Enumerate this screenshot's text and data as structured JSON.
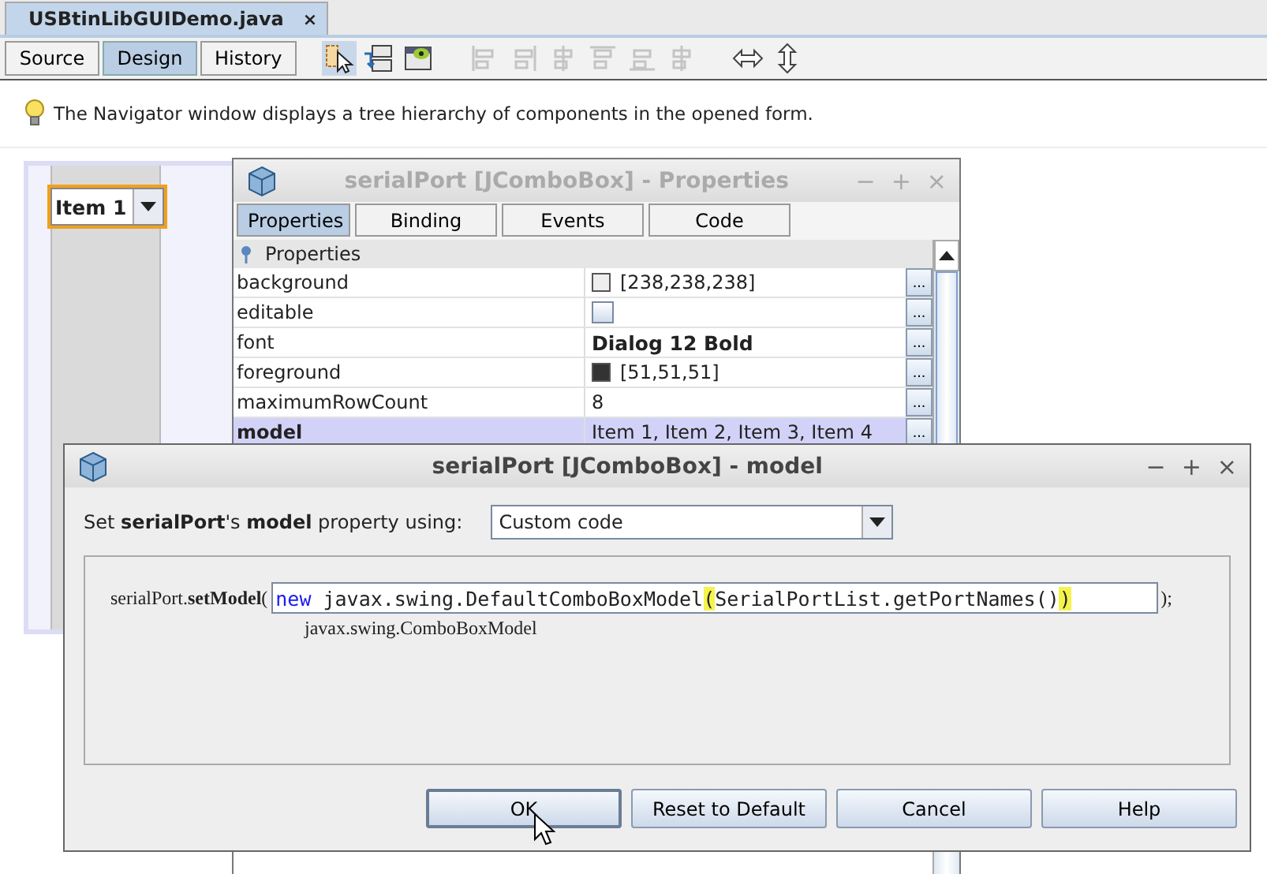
{
  "file_tab": {
    "title": "USBtinLibGUIDemo.java",
    "close": "×",
    "selected": true
  },
  "view_tabs": [
    {
      "label": "Source",
      "selected": false
    },
    {
      "label": "Design",
      "selected": true
    },
    {
      "label": "History",
      "selected": false
    }
  ],
  "tools": [
    {
      "kind": "select",
      "selected": true
    },
    {
      "kind": "connect",
      "selected": false
    },
    {
      "kind": "preview",
      "selected": false
    }
  ],
  "align_tools": [
    {
      "kind": "left",
      "disabled": true
    },
    {
      "kind": "right",
      "disabled": true
    },
    {
      "kind": "center",
      "disabled": true
    },
    {
      "kind": "top",
      "disabled": true
    },
    {
      "kind": "bottom",
      "disabled": true
    },
    {
      "kind": "middle",
      "disabled": true
    }
  ],
  "resize_tools": [
    {
      "kind": "horizontal",
      "disabled": false
    },
    {
      "kind": "vertical",
      "disabled": false
    }
  ],
  "hint": "The Navigator window displays a tree hierarchy of components in the opened form.",
  "form": {
    "combo_value": "Item 1",
    "selected": true
  },
  "properties_window": {
    "title": "serialPort [JComboBox] - Properties",
    "active": false,
    "controls": [
      "−",
      "+",
      "×"
    ],
    "tabs": [
      {
        "label": "Properties",
        "selected": true
      },
      {
        "label": "Binding",
        "selected": false
      },
      {
        "label": "Events",
        "selected": false
      },
      {
        "label": "Code",
        "selected": false
      }
    ],
    "section": "Properties",
    "rows": [
      {
        "name": "background",
        "kind": "color",
        "value": "[238,238,238]",
        "color": "#eeeeee",
        "selected": false,
        "edit": "..."
      },
      {
        "name": "editable",
        "kind": "checkbox",
        "checked": false,
        "selected": false,
        "edit": "..."
      },
      {
        "name": "font",
        "kind": "font",
        "value": "Dialog 12 Bold",
        "selected": false,
        "edit": "..."
      },
      {
        "name": "foreground",
        "kind": "color",
        "value": "[51,51,51]",
        "color": "#333333",
        "selected": false,
        "edit": "..."
      },
      {
        "name": "maximumRowCount",
        "kind": "text",
        "value": "8",
        "selected": false,
        "edit": "..."
      },
      {
        "name": "model",
        "kind": "text",
        "value": "Item 1, Item 2, Item 3, Item 4",
        "selected": true,
        "edit": "..."
      }
    ]
  },
  "model_dialog": {
    "title": "serialPort [JComboBox] - model",
    "active": true,
    "controls": [
      "−",
      "+",
      "×"
    ],
    "prompt": "Set **serialPort**'s **model** property using:",
    "editor_choice": "Custom code",
    "code_prefix": "serialPort.**setModel**(",
    "code_tokens": [
      {
        "text": "new",
        "kind": "keyword"
      },
      {
        "text": " javax.swing.DefaultComboBoxModel",
        "kind": "plain"
      },
      {
        "text": "(",
        "kind": "match"
      },
      {
        "text": "SerialPortList.getPortNames()",
        "kind": "plain"
      },
      {
        "text": ")",
        "kind": "match"
      }
    ],
    "code_suffix": ");",
    "type_hint": "javax.swing.ComboBoxModel",
    "buttons": [
      {
        "label": "OK",
        "default": true
      },
      {
        "label": "Reset to Default",
        "default": false
      },
      {
        "label": "Cancel",
        "default": false
      },
      {
        "label": "Help",
        "default": false
      }
    ]
  }
}
